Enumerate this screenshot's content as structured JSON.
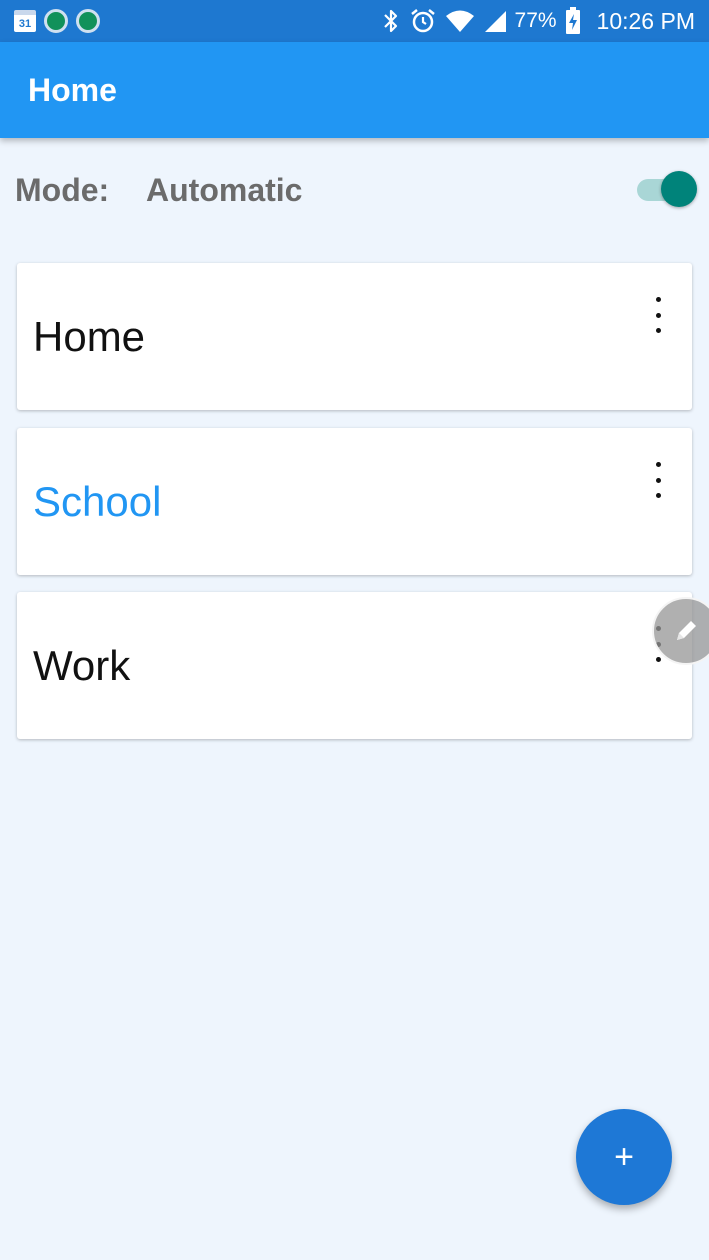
{
  "status_bar": {
    "calendar_date": "31",
    "battery": "77%",
    "time": "10:26 PM",
    "icons": [
      "calendar-icon",
      "app-dot-icon",
      "app-dot-icon",
      "bluetooth-icon",
      "alarm-icon",
      "wifi-icon",
      "signal-icon",
      "battery-charging-icon"
    ]
  },
  "app_bar": {
    "title": "Home"
  },
  "mode": {
    "label": "Mode:",
    "value": "Automatic",
    "toggle_on": true
  },
  "places": [
    {
      "label": "Home",
      "active": false
    },
    {
      "label": "School",
      "active": true
    },
    {
      "label": "Work",
      "active": false
    }
  ],
  "fab": {
    "icon": "plus-icon",
    "symbol": "+"
  },
  "floating_overlay": {
    "icon": "pencil-icon"
  },
  "colors": {
    "status_bar": "#1e78d0",
    "app_bar": "#2196f3",
    "background": "#eef5fd",
    "active_text": "#2196f3",
    "toggle_thumb": "#00837a",
    "toggle_track": "#a9d6d6",
    "fab": "#1e78d6"
  }
}
